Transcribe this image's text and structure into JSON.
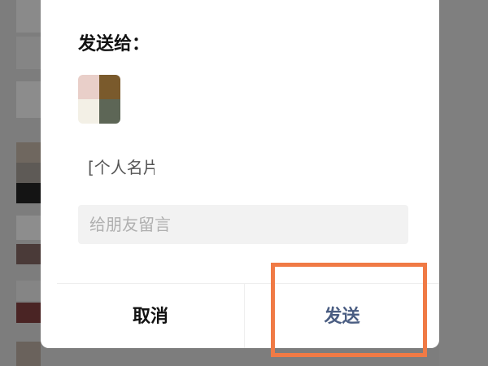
{
  "dialog": {
    "title": "发送给：",
    "card_text": "[个人名片]",
    "message_placeholder": "给朋友留言",
    "cancel_label": "取消",
    "send_label": "发送"
  },
  "colors": {
    "send_text": "#4a5d82",
    "highlight_border": "#f07a45",
    "overlay": "#7d7d7d"
  }
}
